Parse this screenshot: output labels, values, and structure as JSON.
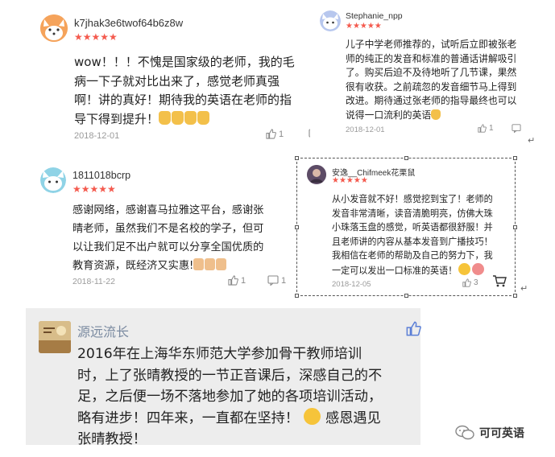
{
  "reviews": [
    {
      "username": "k7jhak3e6twof64b6z8w",
      "stars": "★★★★★",
      "lines": [
        "wow！！！不愧是国家级的老师，我的毛",
        "病一下子就对比出来了，感觉老师真强",
        "啊！讲的真好！期待我的英语在老师的指",
        "导下得到提升！"
      ],
      "date": "2018-12-01",
      "likes": "1",
      "comments": ""
    },
    {
      "username": "Stephanie_npp",
      "stars": "★★★★★",
      "lines": [
        "儿子中学老师推荐的，试听后立即被张老",
        "师的纯正的发音和标准的普通话讲解吸引",
        "了。购买后迫不及待地听了几节课，果然",
        "很有收获。之前疏忽的发音细节马上得到",
        "改进。期待通过张老师的指导最终也可以",
        "说得一口流利的英语"
      ],
      "date": "2018-12-01",
      "likes": "1",
      "comments": ""
    },
    {
      "username": "1811018bcrp",
      "stars": "★★★★★",
      "lines": [
        "感谢网络，感谢喜马拉雅这平台，感谢张",
        "晴老师，虽然我们不是名校的学子，但可",
        "以让我们足不出户就可以分享全国优质的",
        "教育资源，既经济又实惠!"
      ],
      "date": "2018-11-22",
      "likes": "1",
      "comments": "1"
    },
    {
      "username": "安逸__Chifmeek花栗鼠",
      "stars": "★★★★★",
      "lines": [
        "从小发音就不好！感觉挖到宝了！老师的",
        "发音非常清晰，读音清脆明亮，仿佛大珠",
        "小珠落玉盘的感觉，听英语都很舒服！并",
        "且老师讲的内容从基本发音到广播技巧！",
        "我相信在老师的帮助及自己的努力下，我",
        "一定可以发出一口标准的英语！"
      ],
      "date": "2018-12-05",
      "likes": "3",
      "comments": ""
    }
  ],
  "wechat_comment": {
    "username": "源远流长",
    "text_lines": [
      "2016年在上海华东师范大学参加骨干教师培训",
      "时，上了张晴教授的一节正音课后，深感自己的不",
      "足，之后便一场不落地参加了她的各项培训活动，",
      "略有进步！四年来，一直都在坚持！",
      "张晴教授！"
    ],
    "tail": "感恩遇见"
  },
  "watermark": "可可英语",
  "colors": {
    "stars": "#f45a4e",
    "date": "#9a9a9a",
    "wechat_bg": "#ededed",
    "wechat_name": "#7a8aa0",
    "like_blue": "#5b7fd6"
  },
  "icons": [
    "fox-avatar-icon",
    "cat-avatar-icon",
    "thumb-up-icon",
    "comment-icon",
    "wechat-logo-icon",
    "return-mark-icon",
    "cart-icon"
  ]
}
